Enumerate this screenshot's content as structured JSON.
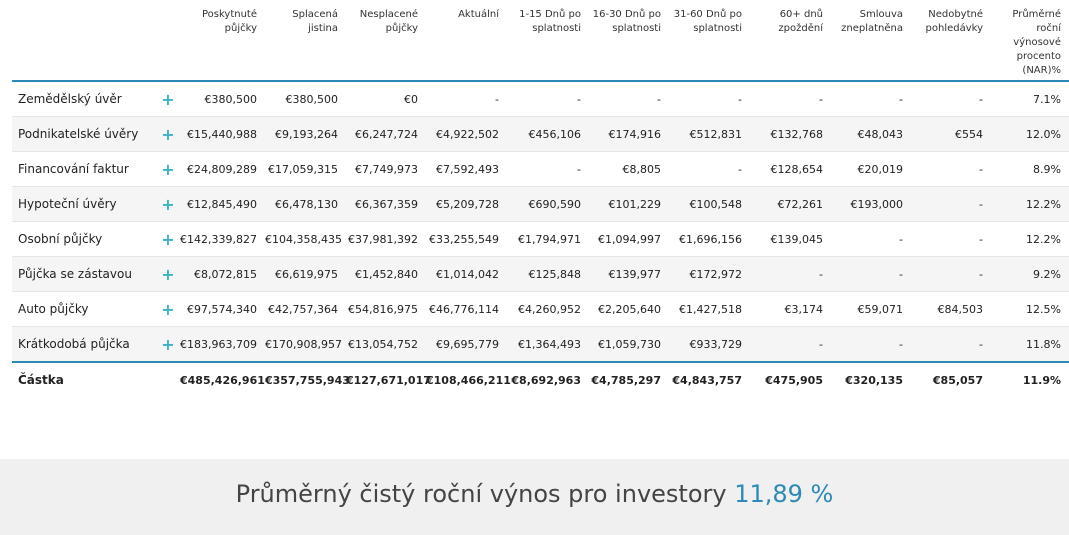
{
  "headers": [
    "Poskytnuté půjčky",
    "Splacená jistina",
    "Nesplacené půjčky",
    "Aktuální",
    "1-15 Dnů po splatnosti",
    "16-30 Dnů po splatnosti",
    "31-60 Dnů po splatnosti",
    "60+ dnů zpoždění",
    "Smlouva zneplatněna",
    "Nedobytné pohledávky",
    "Průměrné roční výnosové procento (NAR)%"
  ],
  "rows": [
    {
      "name": "Zemědělský úvěr",
      "values": [
        "€380,500",
        "€380,500",
        "€0",
        "-",
        "-",
        "-",
        "-",
        "-",
        "-",
        "-",
        "7.1%"
      ]
    },
    {
      "name": "Podnikatelské úvěry",
      "values": [
        "€15,440,988",
        "€9,193,264",
        "€6,247,724",
        "€4,922,502",
        "€456,106",
        "€174,916",
        "€512,831",
        "€132,768",
        "€48,043",
        "€554",
        "12.0%"
      ]
    },
    {
      "name": "Financování faktur",
      "values": [
        "€24,809,289",
        "€17,059,315",
        "€7,749,973",
        "€7,592,493",
        "-",
        "€8,805",
        "-",
        "€128,654",
        "€20,019",
        "-",
        "8.9%"
      ]
    },
    {
      "name": "Hypoteční úvěry",
      "values": [
        "€12,845,490",
        "€6,478,130",
        "€6,367,359",
        "€5,209,728",
        "€690,590",
        "€101,229",
        "€100,548",
        "€72,261",
        "€193,000",
        "-",
        "12.2%"
      ]
    },
    {
      "name": "Osobní půjčky",
      "values": [
        "€142,339,827",
        "€104,358,435",
        "€37,981,392",
        "€33,255,549",
        "€1,794,971",
        "€1,094,997",
        "€1,696,156",
        "€139,045",
        "-",
        "-",
        "12.2%"
      ]
    },
    {
      "name": "Půjčka se zástavou",
      "values": [
        "€8,072,815",
        "€6,619,975",
        "€1,452,840",
        "€1,014,042",
        "€125,848",
        "€139,977",
        "€172,972",
        "-",
        "-",
        "-",
        "9.2%"
      ]
    },
    {
      "name": "Auto půjčky",
      "values": [
        "€97,574,340",
        "€42,757,364",
        "€54,816,975",
        "€46,776,114",
        "€4,260,952",
        "€2,205,640",
        "€1,427,518",
        "€3,174",
        "€59,071",
        "€84,503",
        "12.5%"
      ]
    },
    {
      "name": "Krátkodobá půjčka",
      "values": [
        "€183,963,709",
        "€170,908,957",
        "€13,054,752",
        "€9,695,779",
        "€1,364,493",
        "€1,059,730",
        "€933,729",
        "-",
        "-",
        "-",
        "11.8%"
      ]
    }
  ],
  "total": {
    "name": "Částka",
    "values": [
      "€485,426,961",
      "€357,755,943",
      "€127,671,017",
      "€108,466,211",
      "€8,692,963",
      "€4,785,297",
      "€4,843,757",
      "€475,905",
      "€320,135",
      "€85,057",
      "11.9%"
    ]
  },
  "expand_glyph": "+",
  "banner": {
    "text": "Průměrný čistý roční výnos pro investory",
    "value": "11,89 %"
  },
  "colors": {
    "accent": "#2d89b5",
    "plus": "#3bb3c3"
  }
}
